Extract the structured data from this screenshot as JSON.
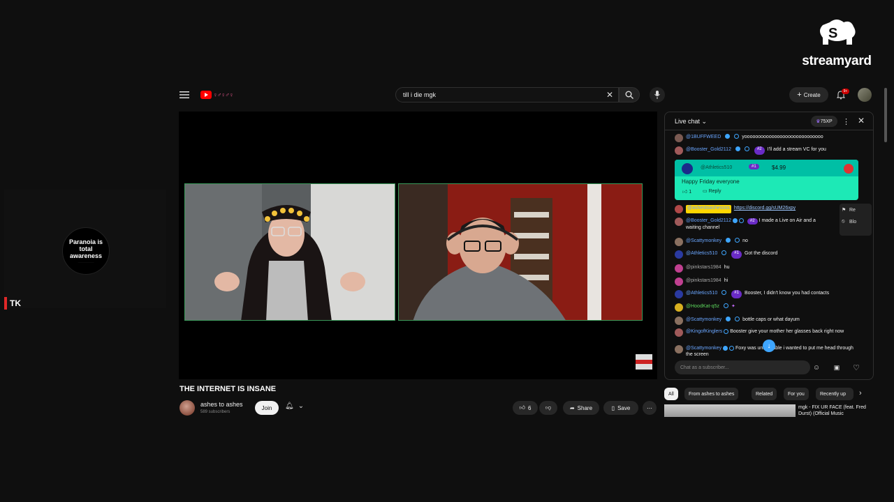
{
  "overlay": {
    "brand": "streamyard",
    "side_card_line1": "Paranoia is",
    "side_card_line2": "total awareness",
    "guest_label": "TK"
  },
  "youtube": {
    "search_value": "till i die mgk",
    "create_label": "Create",
    "notification_count": "9+",
    "video_title": "THE INTERNET IS INSANE",
    "channel_name": "ashes to ashes",
    "channel_subs": "589 subscribers",
    "join_label": "Join",
    "like_count": "6",
    "share_label": "Share",
    "save_label": "Save"
  },
  "chat": {
    "title": "Live chat",
    "xp": "75XP",
    "input_placeholder": "Chat as a subscriber...",
    "messages": [
      {
        "author": "@1BUFFWEED",
        "text": "yooooooooooooooooooooooooooooo"
      },
      {
        "author": "@Booster_Gold2112",
        "rank": "#2",
        "text": "I'll add a stream VC for you"
      },
      {
        "author": "@ashestoashessss",
        "text": "https://discord.gg/sUM26xpy"
      },
      {
        "author": "@Booster_Gold2112",
        "rank": "#2",
        "text": "I made a Live on Air and a waiting channel"
      },
      {
        "author": "@Scattymonkey",
        "text": "no"
      },
      {
        "author": "@Athletics510",
        "rank": "#1",
        "text": "Got the discord"
      },
      {
        "author": "@pinkstars1984",
        "text": "hu"
      },
      {
        "author": "@pinkstars1984",
        "text": "hi"
      },
      {
        "author": "@Athletics510",
        "rank": "#1",
        "text": "Booster, I didn't know you had contacts"
      },
      {
        "author": "@HoodKat-q5z",
        "text": ""
      },
      {
        "author": "@Scattymonkey",
        "text": "bottle caps or what dayum"
      },
      {
        "author": "@KingofKinglers",
        "text": "Booster give your mother her glasses back right now"
      },
      {
        "author": "@Scattymonkey",
        "text": "Foxy was unbearable i wanted to put me head through the screen"
      }
    ],
    "superchat": {
      "author": "@Athletics510",
      "rank": "#1",
      "amount": "$4.99",
      "text": "Happy Friday everyone",
      "likes": "1",
      "reply_label": "Reply"
    },
    "context_menu": [
      "Re",
      "Blo"
    ]
  },
  "chips": [
    "All",
    "From ashes to ashes",
    "Related",
    "For you",
    "Recently up"
  ],
  "recommendation": {
    "title": "mgk - FIX UR FACE (feat. Fred Durst) (Official Music"
  }
}
